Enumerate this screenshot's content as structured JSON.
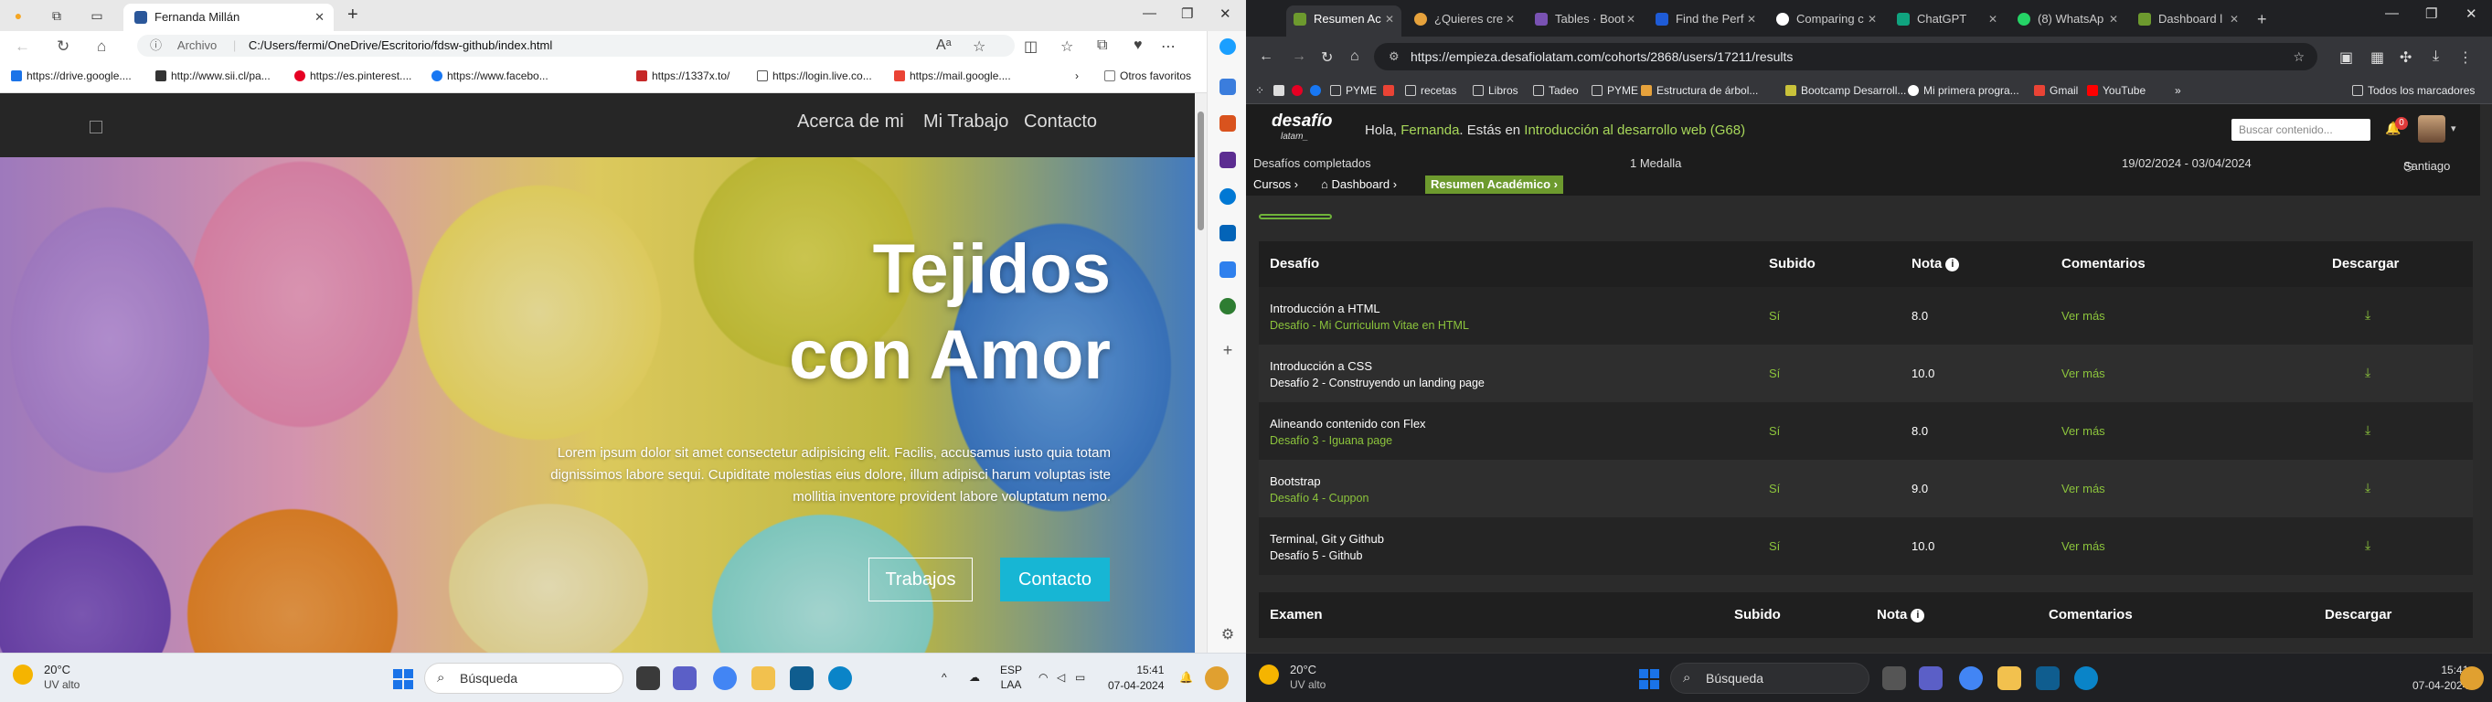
{
  "left_window": {
    "tab_title": "Fernanda Millán",
    "address_label": "Archivo",
    "address_path": "C:/Users/fermi/OneDrive/Escritorio/fdsw-github/index.html",
    "bookmarks": [
      {
        "label": "https://drive.google...."
      },
      {
        "label": "http://www.sii.cl/pa..."
      },
      {
        "label": "https://es.pinterest...."
      },
      {
        "label": "https://www.facebo..."
      },
      {
        "label": "https://1337x.to/"
      },
      {
        "label": "https://login.live.co..."
      },
      {
        "label": "https://mail.google...."
      },
      {
        "label": "Otros favoritos"
      }
    ],
    "site": {
      "nav": [
        "Acerca de mi",
        "Mi Trabajo",
        "Contacto"
      ],
      "hero_title_line1": "Tejidos",
      "hero_title_line2": "con Amor",
      "hero_text": "Lorem ipsum dolor sit amet consectetur adipisicing elit. Facilis, accusamus iusto quia totam dignissimos labore sequi. Cupiditate molestias eius dolore, illum adipisci harum voluptas iste mollitia inventore provident labore voluptatum nemo.",
      "btn_trabajos": "Trabajos",
      "btn_contacto": "Contacto"
    },
    "taskbar": {
      "weather_temp": "20°C",
      "weather_desc": "UV alto",
      "search_label": "Búsqueda",
      "lang_line1": "ESP",
      "lang_line2": "LAA",
      "time": "15:41",
      "date": "07-04-2024"
    }
  },
  "right_window": {
    "tabs": [
      {
        "label": "Resumen Ac",
        "active": true
      },
      {
        "label": "¿Quieres cre"
      },
      {
        "label": "Tables · Boot"
      },
      {
        "label": "Find the Perf"
      },
      {
        "label": "Comparing c"
      },
      {
        "label": "ChatGPT"
      },
      {
        "label": "(8) WhatsAp"
      },
      {
        "label": "Dashboard l"
      }
    ],
    "url": "https://empieza.desafiolatam.com/cohorts/2868/users/17211/results",
    "bookmarks": [
      {
        "label": "PYME"
      },
      {
        "label": "recetas"
      },
      {
        "label": "Libros"
      },
      {
        "label": "Tadeo"
      },
      {
        "label": "PYME"
      },
      {
        "label": "Estructura de árbol..."
      },
      {
        "label": "Bootcamp Desarroll..."
      },
      {
        "label": "Mi primera progra..."
      },
      {
        "label": "Gmail"
      },
      {
        "label": "YouTube"
      },
      {
        "label": "Todos los marcadores"
      }
    ],
    "page": {
      "logo": "desafío",
      "logo_sub": "latam_",
      "greeting_prefix": "Hola,",
      "user_name": "Fernanda",
      "greeting_mid": ". Estás en",
      "course": "Introducción al desarrollo web (G68)",
      "search_placeholder": "Buscar contenido...",
      "notif_count": "0",
      "stats_challenges": "Desafíos completados",
      "stats_medals": "1 Medalla",
      "stats_dates": "19/02/2024 - 03/04/2024",
      "stats_city": "Santiago",
      "crumbs": [
        "Cursos",
        "Dashboard",
        "Resumen Académico"
      ],
      "table1_headers": [
        "Desafío",
        "Subido",
        "Nota",
        "Comentarios",
        "Descargar"
      ],
      "rows": [
        {
          "title": "Introducción a HTML",
          "sub": "Desafío - Mi Curriculum Vitae en HTML",
          "uploaded": "Sí",
          "grade": "8.0",
          "comments": "Ver más"
        },
        {
          "title": "Introducción a CSS",
          "sub": "Desafío 2 - Construyendo un landing page",
          "uploaded": "Sí",
          "grade": "10.0",
          "comments": "Ver más"
        },
        {
          "title": "Alineando contenido con Flex",
          "sub": "Desafío 3 - Iguana page",
          "uploaded": "Sí",
          "grade": "8.0",
          "comments": "Ver más"
        },
        {
          "title": "Bootstrap",
          "sub": "Desafío 4 - Cuppon",
          "uploaded": "Sí",
          "grade": "9.0",
          "comments": "Ver más"
        },
        {
          "title": "Terminal, Git y Github",
          "sub": "Desafío 5 - Github",
          "uploaded": "Sí",
          "grade": "10.0",
          "comments": "Ver más"
        }
      ],
      "table2_headers": [
        "Examen",
        "Subido",
        "Nota",
        "Comentarios",
        "Descargar"
      ]
    },
    "taskbar": {
      "weather_temp": "20°C",
      "weather_desc": "UV alto",
      "search_label": "Búsqueda",
      "time": "15:41",
      "date": "07-04-2024"
    }
  }
}
